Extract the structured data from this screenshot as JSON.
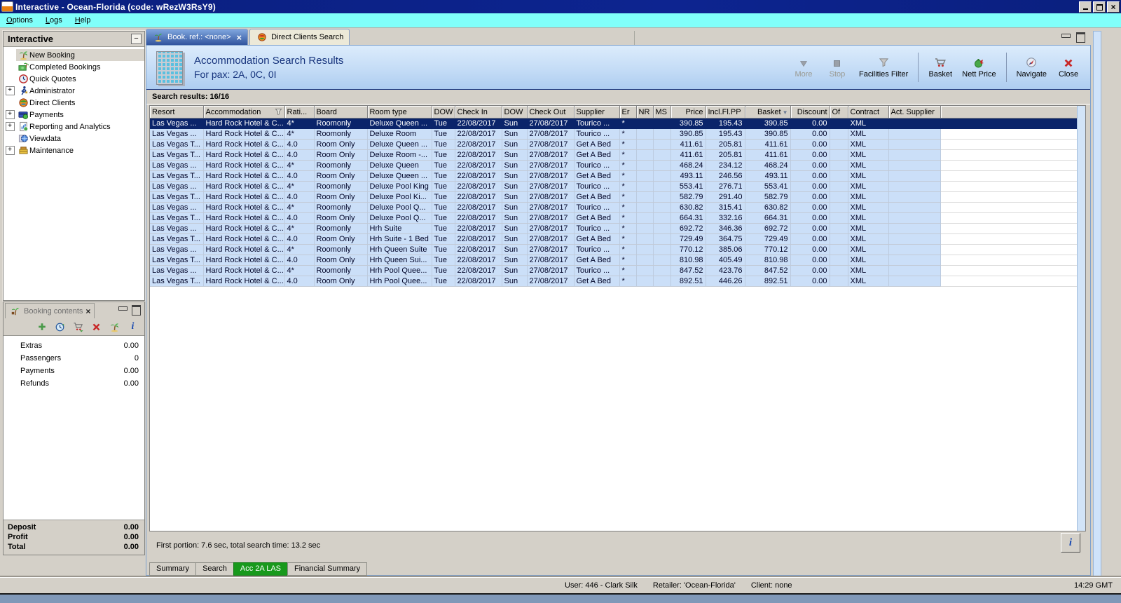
{
  "window": {
    "title": "Interactive - Ocean-Florida (code: wRezW3RsY9)"
  },
  "menu": {
    "options": "Options",
    "logs": "Logs",
    "help": "Help"
  },
  "icons": {
    "close_glyph": "×",
    "collapse_glyph": "−",
    "expand_glyph": "+",
    "sort_glyph": "▼"
  },
  "colors": {
    "titlebar": "#0d2490",
    "menu_bg": "#80fffa",
    "selected_row": "#0a246a",
    "row_bg": "#cbdff8",
    "active_bottom_tab": "#18991c",
    "header_band_text": "#16337c"
  },
  "sidebar": {
    "title": "Interactive",
    "items": [
      {
        "label": "New Booking",
        "icon": "palm-icon",
        "expandable": false,
        "selected": true
      },
      {
        "label": "Completed Bookings",
        "icon": "money-palm-icon",
        "expandable": false
      },
      {
        "label": "Quick Quotes",
        "icon": "clock-icon",
        "expandable": false
      },
      {
        "label": "Administrator",
        "icon": "runner-icon",
        "expandable": true
      },
      {
        "label": "Direct Clients",
        "icon": "globe-icon",
        "expandable": false
      },
      {
        "label": "Payments",
        "icon": "payments-icon",
        "expandable": true
      },
      {
        "label": "Reporting and Analytics",
        "icon": "report-icon",
        "expandable": true
      },
      {
        "label": "Viewdata",
        "icon": "viewdata-icon",
        "expandable": false
      },
      {
        "label": "Maintenance",
        "icon": "maintenance-icon",
        "expandable": true
      }
    ]
  },
  "booking_contents": {
    "title": "Booking contents",
    "rows": [
      {
        "label": "Extras",
        "value": "0.00"
      },
      {
        "label": "Passengers",
        "value": "0"
      },
      {
        "label": "Payments",
        "value": "0.00"
      },
      {
        "label": "Refunds",
        "value": "0.00"
      }
    ],
    "totals": [
      {
        "label": "Deposit",
        "value": "0.00"
      },
      {
        "label": "Profit",
        "value": "0.00"
      },
      {
        "label": "Total",
        "value": "0.00"
      }
    ]
  },
  "tabs": [
    {
      "label": "Book. ref.: <none>",
      "active": true
    },
    {
      "label": "Direct Clients Search",
      "active": false
    }
  ],
  "header": {
    "title": "Accommodation Search Results",
    "subtitle": "For pax: 2A, 0C, 0I"
  },
  "toolbar": {
    "more": "More",
    "stop": "Stop",
    "facilities_filter": "Facilities Filter",
    "basket": "Basket",
    "nett_price": "Nett Price",
    "navigate": "Navigate",
    "close": "Close"
  },
  "results": {
    "summary": "Search results: 16/16"
  },
  "table": {
    "selected_index": 0,
    "columns": [
      "Resort",
      "Accommodation",
      "Rati...",
      "Board",
      "Room type",
      "DOW",
      "Check In",
      "DOW",
      "Check Out",
      "Supplier",
      "Er",
      "NR",
      "MS",
      "Price",
      "Incl.Fl.PP",
      "Basket",
      "Discount",
      "Of",
      "Contract",
      "Act. Supplier"
    ],
    "rows": [
      [
        "Las Vegas ...",
        "Hard Rock Hotel & C...",
        "4*",
        "Roomonly",
        "Deluxe Queen ...",
        "Tue",
        "22/08/2017",
        "Sun",
        "27/08/2017",
        "Tourico ...",
        "*",
        "",
        "",
        "390.85",
        "195.43",
        "390.85",
        "0.00",
        "",
        "XML",
        ""
      ],
      [
        "Las Vegas ...",
        "Hard Rock Hotel & C...",
        "4*",
        "Roomonly",
        "Deluxe Room",
        "Tue",
        "22/08/2017",
        "Sun",
        "27/08/2017",
        "Tourico ...",
        "*",
        "",
        "",
        "390.85",
        "195.43",
        "390.85",
        "0.00",
        "",
        "XML",
        ""
      ],
      [
        "Las Vegas T...",
        "Hard Rock Hotel & C...",
        "4.0",
        "Room Only",
        "Deluxe Queen ...",
        "Tue",
        "22/08/2017",
        "Sun",
        "27/08/2017",
        "Get A Bed",
        "*",
        "",
        "",
        "411.61",
        "205.81",
        "411.61",
        "0.00",
        "",
        "XML",
        ""
      ],
      [
        "Las Vegas T...",
        "Hard Rock Hotel & C...",
        "4.0",
        "Room Only",
        "Deluxe Room -...",
        "Tue",
        "22/08/2017",
        "Sun",
        "27/08/2017",
        "Get A Bed",
        "*",
        "",
        "",
        "411.61",
        "205.81",
        "411.61",
        "0.00",
        "",
        "XML",
        ""
      ],
      [
        "Las Vegas ...",
        "Hard Rock Hotel & C...",
        "4*",
        "Roomonly",
        "Deluxe Queen",
        "Tue",
        "22/08/2017",
        "Sun",
        "27/08/2017",
        "Tourico ...",
        "*",
        "",
        "",
        "468.24",
        "234.12",
        "468.24",
        "0.00",
        "",
        "XML",
        ""
      ],
      [
        "Las Vegas T...",
        "Hard Rock Hotel & C...",
        "4.0",
        "Room Only",
        "Deluxe Queen ...",
        "Tue",
        "22/08/2017",
        "Sun",
        "27/08/2017",
        "Get A Bed",
        "*",
        "",
        "",
        "493.11",
        "246.56",
        "493.11",
        "0.00",
        "",
        "XML",
        ""
      ],
      [
        "Las Vegas ...",
        "Hard Rock Hotel & C...",
        "4*",
        "Roomonly",
        "Deluxe Pool King",
        "Tue",
        "22/08/2017",
        "Sun",
        "27/08/2017",
        "Tourico ...",
        "*",
        "",
        "",
        "553.41",
        "276.71",
        "553.41",
        "0.00",
        "",
        "XML",
        ""
      ],
      [
        "Las Vegas T...",
        "Hard Rock Hotel & C...",
        "4.0",
        "Room Only",
        "Deluxe Pool Ki...",
        "Tue",
        "22/08/2017",
        "Sun",
        "27/08/2017",
        "Get A Bed",
        "*",
        "",
        "",
        "582.79",
        "291.40",
        "582.79",
        "0.00",
        "",
        "XML",
        ""
      ],
      [
        "Las Vegas ...",
        "Hard Rock Hotel & C...",
        "4*",
        "Roomonly",
        "Deluxe Pool Q...",
        "Tue",
        "22/08/2017",
        "Sun",
        "27/08/2017",
        "Tourico ...",
        "*",
        "",
        "",
        "630.82",
        "315.41",
        "630.82",
        "0.00",
        "",
        "XML",
        ""
      ],
      [
        "Las Vegas T...",
        "Hard Rock Hotel & C...",
        "4.0",
        "Room Only",
        "Deluxe Pool Q...",
        "Tue",
        "22/08/2017",
        "Sun",
        "27/08/2017",
        "Get A Bed",
        "*",
        "",
        "",
        "664.31",
        "332.16",
        "664.31",
        "0.00",
        "",
        "XML",
        ""
      ],
      [
        "Las Vegas ...",
        "Hard Rock Hotel & C...",
        "4*",
        "Roomonly",
        "Hrh Suite",
        "Tue",
        "22/08/2017",
        "Sun",
        "27/08/2017",
        "Tourico ...",
        "*",
        "",
        "",
        "692.72",
        "346.36",
        "692.72",
        "0.00",
        "",
        "XML",
        ""
      ],
      [
        "Las Vegas T...",
        "Hard Rock Hotel & C...",
        "4.0",
        "Room Only",
        "Hrh Suite - 1 Bed",
        "Tue",
        "22/08/2017",
        "Sun",
        "27/08/2017",
        "Get A Bed",
        "*",
        "",
        "",
        "729.49",
        "364.75",
        "729.49",
        "0.00",
        "",
        "XML",
        ""
      ],
      [
        "Las Vegas ...",
        "Hard Rock Hotel & C...",
        "4*",
        "Roomonly",
        "Hrh Queen Suite",
        "Tue",
        "22/08/2017",
        "Sun",
        "27/08/2017",
        "Tourico ...",
        "*",
        "",
        "",
        "770.12",
        "385.06",
        "770.12",
        "0.00",
        "",
        "XML",
        ""
      ],
      [
        "Las Vegas T...",
        "Hard Rock Hotel & C...",
        "4.0",
        "Room Only",
        "Hrh Queen Sui...",
        "Tue",
        "22/08/2017",
        "Sun",
        "27/08/2017",
        "Get A Bed",
        "*",
        "",
        "",
        "810.98",
        "405.49",
        "810.98",
        "0.00",
        "",
        "XML",
        ""
      ],
      [
        "Las Vegas ...",
        "Hard Rock Hotel & C...",
        "4*",
        "Roomonly",
        "Hrh Pool Quee...",
        "Tue",
        "22/08/2017",
        "Sun",
        "27/08/2017",
        "Tourico ...",
        "*",
        "",
        "",
        "847.52",
        "423.76",
        "847.52",
        "0.00",
        "",
        "XML",
        ""
      ],
      [
        "Las Vegas T...",
        "Hard Rock Hotel & C...",
        "4.0",
        "Room Only",
        "Hrh Pool Quee...",
        "Tue",
        "22/08/2017",
        "Sun",
        "27/08/2017",
        "Get A Bed",
        "*",
        "",
        "",
        "892.51",
        "446.26",
        "892.51",
        "0.00",
        "",
        "XML",
        ""
      ]
    ]
  },
  "footer": {
    "timing": "First portion: 7.6 sec, total search time: 13.2 sec",
    "info_label": "i"
  },
  "bottom_tabs": [
    {
      "label": "Summary",
      "active": false
    },
    {
      "label": "Search",
      "active": false
    },
    {
      "label": "Acc 2A LAS",
      "active": true
    },
    {
      "label": "Financial Summary",
      "active": false
    }
  ],
  "statusbar": {
    "user": "User: 446 - Clark Silk",
    "retailer": "Retailer: 'Ocean-Florida'",
    "client": "Client: none",
    "time": "14:29 GMT"
  }
}
